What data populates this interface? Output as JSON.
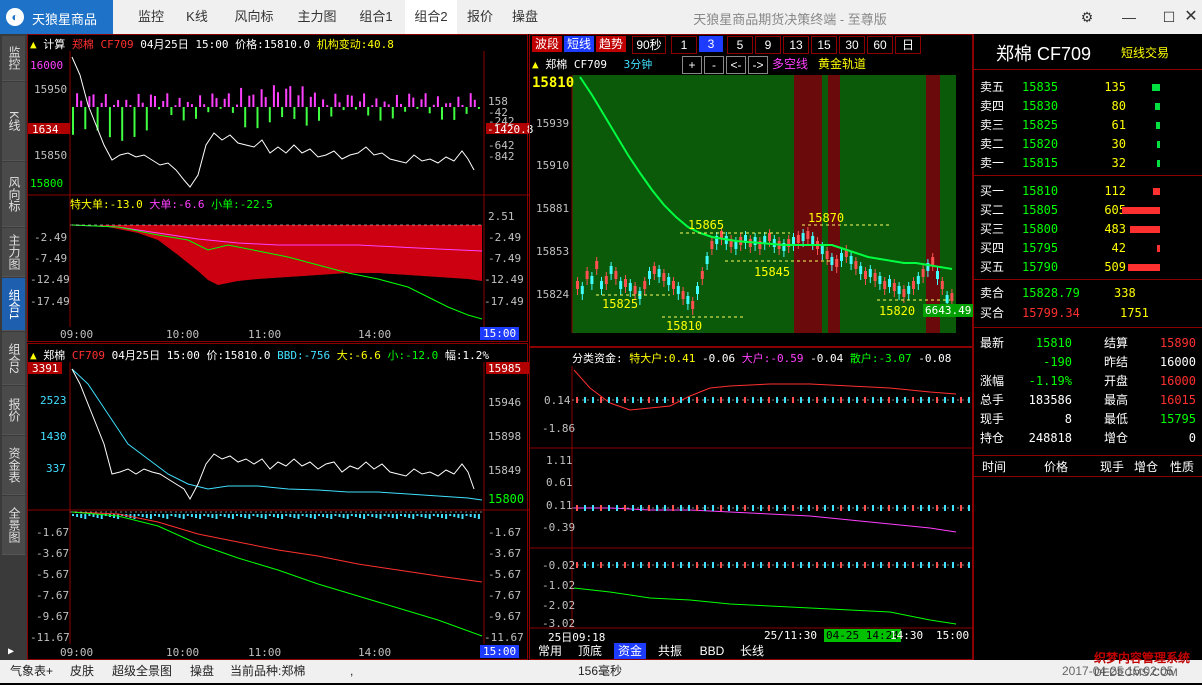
{
  "titlebar": {
    "logo_text": "天狼星商品",
    "menu": [
      "监控",
      "K线",
      "风向标",
      "主力图",
      "组合1",
      "组合2",
      "报价",
      "操盘"
    ],
    "active_menu": "组合2",
    "app_title": "天狼星商品期货决策终端 - 至尊版",
    "icons": [
      "settings-icon",
      "minimize-icon",
      "maximize-icon",
      "close-icon"
    ]
  },
  "vtabs": [
    "监控",
    "K线",
    "风向标",
    "主力图",
    "组合1",
    "组合2",
    "报价",
    "资金表",
    "全景图"
  ],
  "tl": {
    "header": {
      "mark": "▲",
      "name": "计算",
      "code": "郑棉 CF709",
      "date": "04月25日 15:00",
      "price": "价格:15810.0",
      "change": "机构变动:40.8"
    },
    "left_axis": [
      "16000",
      "15950",
      "1634",
      "15850",
      "15800"
    ],
    "right_axis": [
      "158",
      "-42",
      "-242",
      "-1420.8",
      "-642",
      "-842"
    ],
    "sub_header": {
      "a": "特大单:-13.0",
      "b": "大单:-6.6",
      "c": "小单:-22.5"
    },
    "sub_left": [
      "-2.49",
      "-7.49",
      "-12.49",
      "-17.49"
    ],
    "sub_right": [
      "2.51",
      "-2.49",
      "-7.49",
      "-12.49",
      "-17.49"
    ],
    "time_axis": [
      "09:00",
      "10:00",
      "11:00",
      "14:00",
      "15:00"
    ]
  },
  "bl": {
    "header": {
      "mark": "▲",
      "name": "郑棉",
      "code": "CF709",
      "date": "04月25日 15:00",
      "price": "价:15810.0",
      "bbd": "BBD:-756",
      "big": "大:-6.6",
      "small": "小:-12.0",
      "amp": "幅:1.2%"
    },
    "left_axis": [
      "3391",
      "2523",
      "1430",
      "337"
    ],
    "right_axis": [
      "15985",
      "15946",
      "15898",
      "15849",
      "15800"
    ],
    "sub_left": [
      "-1.67",
      "-3.67",
      "-5.67",
      "-7.67",
      "-9.67",
      "-11.67"
    ],
    "sub_right": [
      "-1.67",
      "-3.67",
      "-5.67",
      "-7.67",
      "-9.67",
      "-11.67"
    ],
    "time_axis": [
      "09:00",
      "10:00",
      "11:00",
      "14:00",
      "15:00"
    ]
  },
  "kc": {
    "buttons": [
      "波段",
      "短线",
      "趋势",
      "90秒",
      "1",
      "3",
      "5",
      "9",
      "13",
      "15",
      "30",
      "60",
      "日"
    ],
    "header": {
      "mark": "▲",
      "name": "郑棉",
      "code": "CF709",
      "period": "3分钟",
      "plus": "+",
      "minus": "-",
      "left": "<-",
      "right": "->",
      "duokong": "多空线",
      "gold": "黄金轨道"
    },
    "price_top": "15810",
    "price_axis": [
      "15939",
      "15910",
      "15881",
      "15853",
      "15824"
    ],
    "labels": [
      "15865",
      "15870",
      "15845",
      "15825",
      "15810",
      "15820",
      "6643.49"
    ]
  },
  "fund": {
    "header": {
      "title": "分类资金:",
      "a": "特大户:0.41",
      "a2": "-0.06",
      "b": "大户:-0.59",
      "b2": "-0.04",
      "c": "散户:-3.07",
      "c2": "-0.08"
    },
    "axis1": [
      "0.14",
      "-1.86"
    ],
    "axis2": [
      "1.11",
      "0.61",
      "0.11",
      "-0.39"
    ],
    "axis3": [
      "-0.02",
      "-1.02",
      "-2.02",
      "-3.02"
    ],
    "time_axis": [
      "25日09:18",
      "25/11:30",
      "04-25 14:24",
      "14:30",
      "15:00"
    ],
    "tabs": [
      "常用",
      "顶底",
      "资金",
      "共振",
      "BBD",
      "长线"
    ],
    "active_tab": "资金"
  },
  "quote": {
    "name": "郑棉 CF709",
    "mode": "短线交易",
    "sells": [
      {
        "label": "卖五",
        "price": "15835",
        "vol": "135",
        "bar": 0.08
      },
      {
        "label": "卖四",
        "price": "15830",
        "vol": "80",
        "bar": 0.05
      },
      {
        "label": "卖三",
        "price": "15825",
        "vol": "61",
        "bar": 0.04
      },
      {
        "label": "卖二",
        "price": "15820",
        "vol": "30",
        "bar": 0.02
      },
      {
        "label": "卖一",
        "price": "15815",
        "vol": "32",
        "bar": 0.02
      }
    ],
    "buys": [
      {
        "label": "买一",
        "price": "15810",
        "vol": "112",
        "bar": 0.07
      },
      {
        "label": "买二",
        "price": "15805",
        "vol": "605",
        "bar": 0.38
      },
      {
        "label": "买三",
        "price": "15800",
        "vol": "483",
        "bar": 0.3
      },
      {
        "label": "买四",
        "price": "15795",
        "vol": "42",
        "bar": 0.03
      },
      {
        "label": "买五",
        "price": "15790",
        "vol": "509",
        "bar": 0.32
      }
    ],
    "sell_agg": {
      "label": "卖合",
      "price": "15828.79",
      "vol": "338"
    },
    "buy_agg": {
      "label": "买合",
      "price": "15799.34",
      "vol": "1751"
    },
    "stats": [
      [
        "最新",
        "15810",
        "结算",
        "15890"
      ],
      [
        "",
        "-190",
        "昨结",
        "16000"
      ],
      [
        "涨幅",
        "-1.19%",
        "开盘",
        "16000"
      ],
      [
        "总手",
        "183586",
        "最高",
        "16015"
      ],
      [
        "现手",
        "8",
        "最低",
        "15795"
      ],
      [
        "持仓",
        "248818",
        "增仓",
        "0"
      ]
    ],
    "table_headers": [
      "时间",
      "价格",
      "现手",
      "增仓",
      "性质"
    ]
  },
  "statusbar": {
    "items": [
      "气象表+",
      "皮肤",
      "超级全景图",
      "操盘",
      "当前品种:郑棉",
      ",",
      "156毫秒"
    ],
    "time": "2017-04-25 15:02:05",
    "watermark": "织梦内容管理系统",
    "watermark_url": "DEDECMS.COM"
  }
}
